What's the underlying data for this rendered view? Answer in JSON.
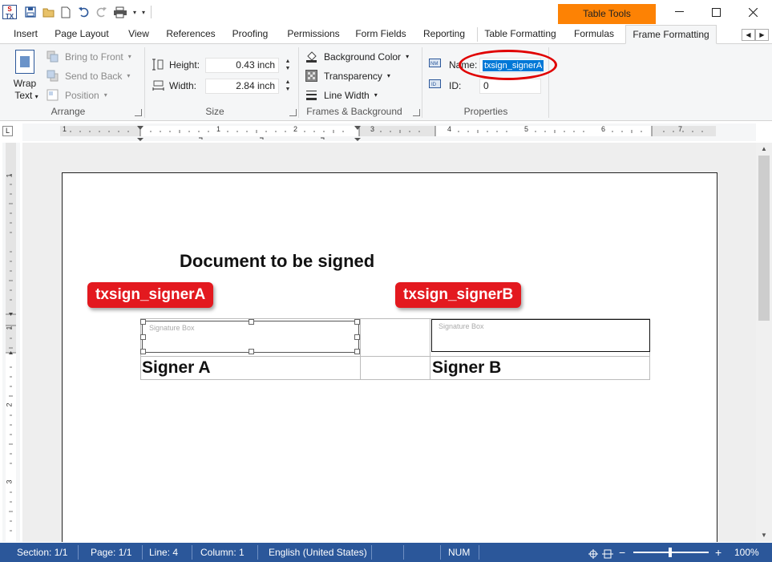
{
  "titlebar": {
    "app_icon_text_top": "S",
    "app_icon_text_bottom": "TX",
    "context_group": "Table Tools"
  },
  "tabs": [
    {
      "label": "Insert"
    },
    {
      "label": "Page Layout"
    },
    {
      "label": "View"
    },
    {
      "label": "References"
    },
    {
      "label": "Proofing"
    },
    {
      "label": "Permissions"
    },
    {
      "label": "Form Fields"
    },
    {
      "label": "Reporting"
    },
    {
      "label": "Table Formatting"
    },
    {
      "label": "Formulas"
    },
    {
      "label": "Frame Formatting",
      "active": true
    }
  ],
  "ribbon": {
    "arrange": {
      "wrap_text_line1": "Wrap",
      "wrap_text_line2": "Text",
      "bring_to_front": "Bring to Front",
      "send_to_back": "Send to Back",
      "position": "Position",
      "label": "Arrange"
    },
    "size": {
      "height_label": "Height:",
      "height_value": "0.43  inch",
      "width_label": "Width:",
      "width_value": "2.84  inch",
      "label": "Size"
    },
    "frames": {
      "background_color": "Background Color",
      "transparency": "Transparency",
      "line_width": "Line Width",
      "label": "Frames & Background"
    },
    "properties": {
      "name_label": "Name:",
      "name_value": "txsign_signerA",
      "id_label": "ID:",
      "id_value": "0",
      "label": "Properties"
    }
  },
  "ruler": {
    "h_numbers": [
      "1",
      "1",
      "2",
      "3",
      "4",
      "5",
      "6",
      "7"
    ],
    "v_numbers": [
      "1",
      "1",
      "2",
      "3"
    ]
  },
  "document": {
    "title": "Document to be signed",
    "tag_a": "txsign_signerA",
    "tag_b": "txsign_signerB",
    "sig_box_label_a": "Signature Box",
    "sig_box_label_b": "Signature Box",
    "signer_a": "Signer A",
    "signer_b": "Signer  B"
  },
  "statusbar": {
    "section": "Section: 1/1",
    "page": "Page: 1/1",
    "line": "Line: 4",
    "column": "Column: 1",
    "language": "English (United States)",
    "num": "NUM",
    "zoom": "100%",
    "zoom_level_percent": 100
  },
  "colors": {
    "accent": "#2b579a",
    "context_tab": "#fd8204",
    "tag_red": "#e3191f",
    "selection": "#0078d7"
  }
}
